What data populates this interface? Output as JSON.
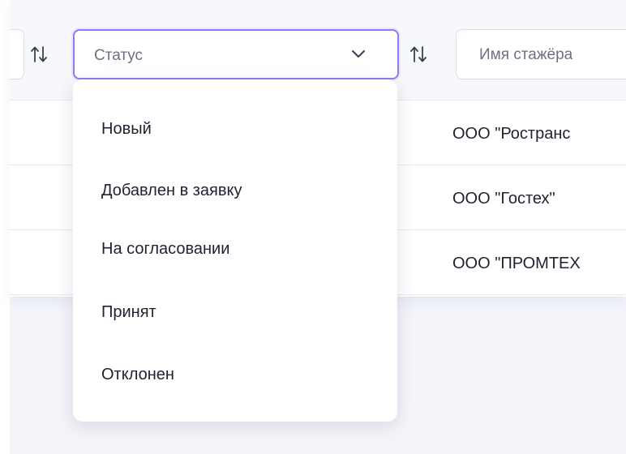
{
  "filters": {
    "status": {
      "placeholder": "Статус"
    },
    "intern_name": {
      "placeholder": "Имя стажёра"
    }
  },
  "status_options": [
    "Новый",
    "Добавлен в заявку",
    "На согласовании",
    "Принят",
    "Отклонен"
  ],
  "rows": [
    {
      "company": "ООО \"Ространс"
    },
    {
      "company": "ООО \"Гостех\""
    },
    {
      "company": "ООО \"ПРОМТЕХ"
    }
  ],
  "colors": {
    "accent": "#8f7cf0",
    "background": "#f4f5fa",
    "border": "#dcdfe8",
    "text": "#1f2230",
    "placeholder": "#6c7080"
  },
  "icons": {
    "sort": "sort-arrows-icon",
    "dropdown": "chevron-down-icon"
  }
}
